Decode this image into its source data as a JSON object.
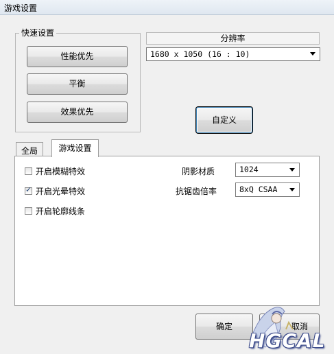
{
  "window": {
    "title": "游戏设置"
  },
  "quick": {
    "legend": "快速设置",
    "buttons": [
      "性能优先",
      "平衡",
      "效果优先"
    ]
  },
  "resolution": {
    "header": "分辨率",
    "value": "1680 x 1050 (16 : 10)",
    "custom_button": "自定义"
  },
  "tabs": [
    {
      "label": "全局",
      "active": false
    },
    {
      "label": "游戏设置",
      "active": true
    }
  ],
  "options": {
    "checkboxes": [
      {
        "label": "开启模糊特效",
        "checked": false
      },
      {
        "label": "开启光晕特效",
        "checked": true
      },
      {
        "label": "开启轮廓线条",
        "checked": false
      }
    ],
    "shadow": {
      "label": "阴影材质",
      "value": "1024"
    },
    "aa": {
      "label": "抗锯齿倍率",
      "value": "8xQ CSAA"
    }
  },
  "footer": {
    "ok": "确定",
    "cancel": "取消"
  },
  "watermark": {
    "text": "HGCAL",
    "icon": "anime-character-logo"
  }
}
